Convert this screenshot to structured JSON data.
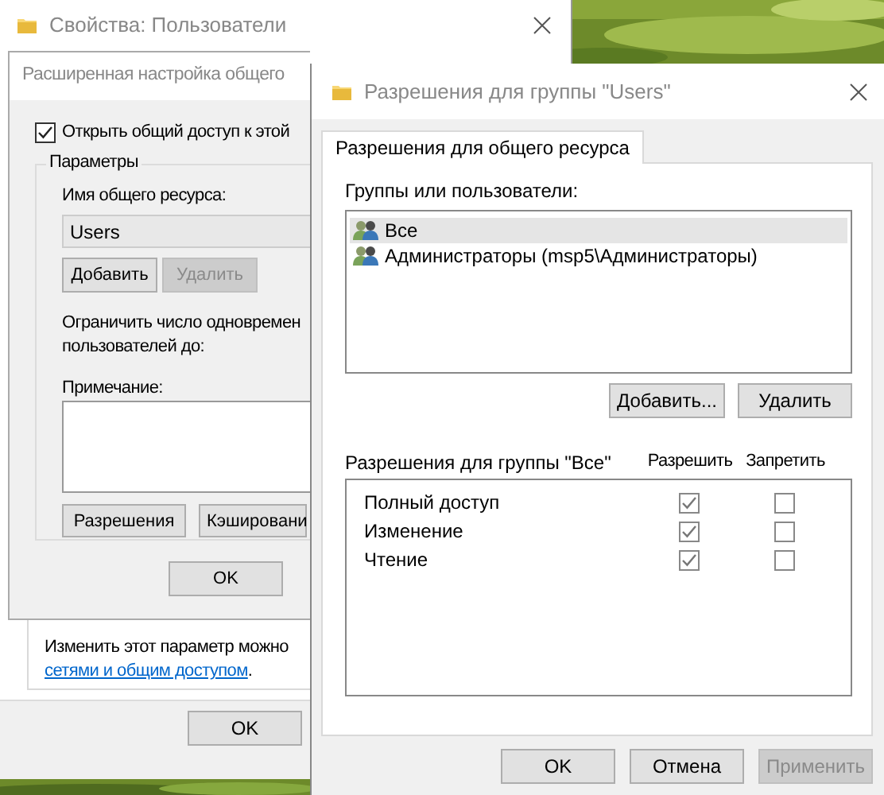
{
  "properties_window": {
    "title": "Свойства: Пользователи",
    "note": {
      "text": "Изменить этот параметр можно",
      "link": "сетями и общим доступом",
      "after": "."
    },
    "buttons": [
      "OK"
    ]
  },
  "advanced_window": {
    "title": "Расширенная настройка общего",
    "share_checkbox": {
      "label": "Открыть общий доступ к этой",
      "checked": true
    },
    "group_title": "Параметры",
    "share_name_label": "Имя общего ресурса:",
    "share_name": "Users",
    "share_buttons": [
      {
        "label": "Добавить",
        "disabled": false
      },
      {
        "label": "Удалить",
        "disabled": true
      }
    ],
    "limit_lines": [
      "Ограничить число одновремен",
      "пользователей до:"
    ],
    "comment_label": "Примечание:",
    "bottom_buttons": [
      "Разрешения",
      "Кэшировани"
    ],
    "buttons": [
      "OK"
    ]
  },
  "permissions_window": {
    "title": "Разрешения для группы \"Users\"",
    "tabs": [
      {
        "label": "Разрешения для общего ресурса",
        "selected": true
      }
    ],
    "groups_label": "Группы или пользователи:",
    "groups": [
      {
        "name": "Все",
        "selected": true
      },
      {
        "name": "Администраторы (msp5\\Администраторы)",
        "selected": false
      }
    ],
    "group_buttons": [
      "Добавить...",
      "Удалить"
    ],
    "permissions_label": "Разрешения для группы \"Все\"",
    "columns": [
      "Разрешить",
      "Запретить"
    ],
    "permissions": [
      {
        "name": "Полный доступ",
        "allow": true,
        "deny": false
      },
      {
        "name": "Изменение",
        "allow": true,
        "deny": false
      },
      {
        "name": "Чтение",
        "allow": true,
        "deny": false
      }
    ],
    "buttons": [
      {
        "label": "OK",
        "disabled": false
      },
      {
        "label": "Отмена",
        "disabled": false
      },
      {
        "label": "Применить",
        "disabled": true
      }
    ]
  }
}
